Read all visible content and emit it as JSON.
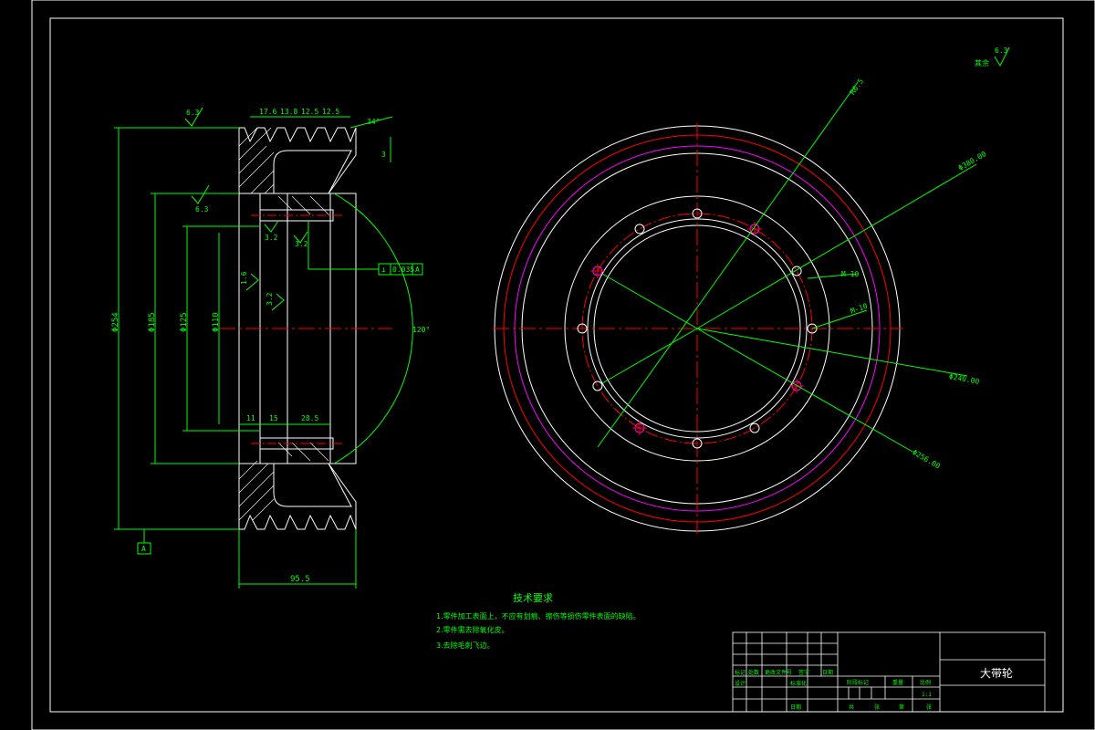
{
  "drawing": {
    "title": "大带轮",
    "colors": {
      "outline": "#ffffff",
      "dimension": "#00ff00",
      "center": "#ff0000",
      "magenta": "#ff00ff",
      "hatch": "#ffffff"
    }
  },
  "roughness": {
    "corner_label": "其余",
    "corner_value": "6.3",
    "top_left": "6.3",
    "hub": "6.3",
    "bore_a": "3.2",
    "bore_b": "3.2",
    "inner_a": "1.6",
    "inner_b": "3.2"
  },
  "dims": {
    "top_1": "17.6",
    "top_2": "13.8",
    "top_3": "12.5",
    "top_4": "12.5",
    "angle_top": "34°",
    "right_small": "3",
    "dia_outer": "Φ254",
    "dia_2": "Φ185",
    "dia_3": "Φ125",
    "dia_4": "Φ110",
    "bottom_1": "11",
    "bottom_2": "15",
    "bottom_3": "28.5",
    "width": "95.5",
    "arc_angle": "120°",
    "datum": "A",
    "tolerance_sym": "⊥",
    "tolerance_val": "0.035",
    "tolerance_ref": "A",
    "rv_1": "R6.5",
    "rv_2": "Φ380.00",
    "rv_3": "M-10",
    "rv_4": "M-10",
    "rv_5": "Φ240.00",
    "rv_6": "Φ256.00"
  },
  "notes": {
    "heading": "技术要求",
    "line_1": "1.零件加工表面上，不应有划痕、擦伤等损伤零件表面的缺陷。",
    "line_2": "2.零件需去除氧化皮。",
    "line_3": "3.去除毛刺飞边。"
  },
  "title_block": {
    "row_a_1": "标记",
    "row_a_2": "处数",
    "row_a_3": "更改文件号",
    "row_a_4": "签字",
    "row_a_5": "日期",
    "row_b_1": "设计",
    "row_b_2": "标准化",
    "mid_1": "阶段标记",
    "mid_2": "重量",
    "mid_3": "比例",
    "scale": "1:1",
    "bottom_1": "共",
    "bottom_2": "张",
    "bottom_3": "第",
    "bottom_4": "张",
    "approved": "日期"
  }
}
